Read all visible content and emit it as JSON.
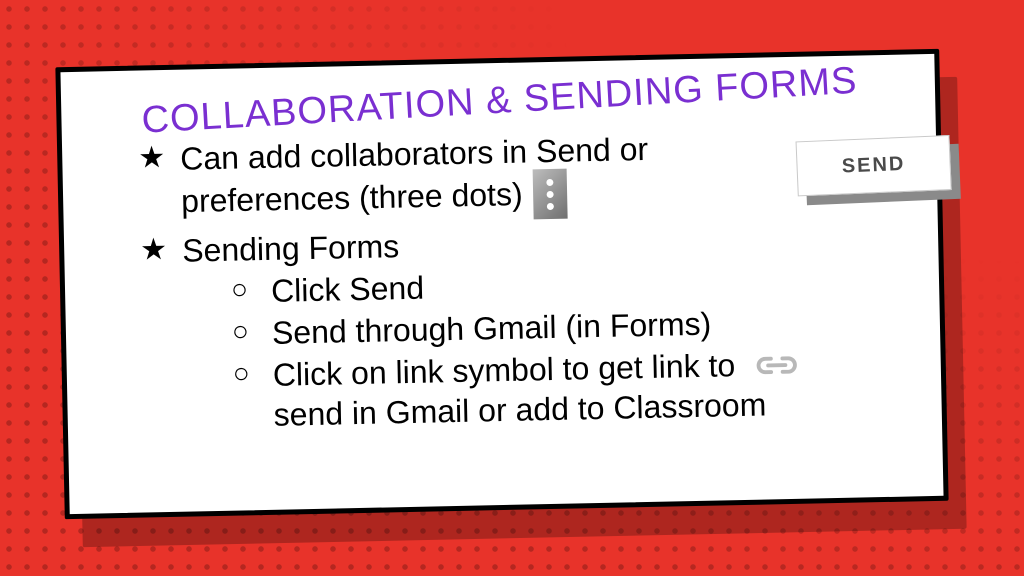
{
  "title": "Collaboration & Sending Forms",
  "bullets": {
    "item1_a": "Can add collaborators in Send or",
    "item1_b": "preferences (three dots)",
    "item2": "Sending Forms",
    "sub1": "Click Send",
    "sub2": "Send through Gmail (in Forms)",
    "sub3_a": "Click on link symbol to get link to",
    "sub3_b": "send in Gmail or add to Classroom"
  },
  "send_button": {
    "label": "SEND"
  }
}
